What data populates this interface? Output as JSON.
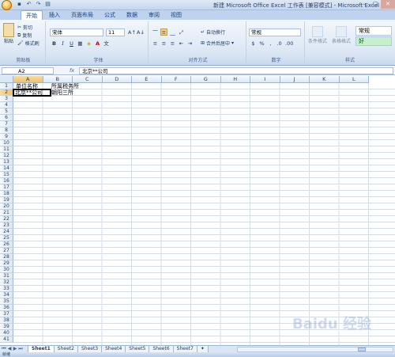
{
  "window": {
    "title": "新建 Microsoft Office Excel 工作表 [兼容模式] - Microsoft Excel",
    "quick_access": [
      "save-icon",
      "undo-icon",
      "redo-icon",
      "print-preview-icon"
    ]
  },
  "ribbon": {
    "tabs": [
      "开始",
      "插入",
      "页面布局",
      "公式",
      "数据",
      "审阅",
      "视图"
    ],
    "active_tab": "开始",
    "clipboard": {
      "paste": "粘贴",
      "cut": "剪切",
      "copy": "复制",
      "format_painter": "格式刷",
      "label": "剪贴板"
    },
    "font": {
      "name": "宋体",
      "size": "11",
      "label": "字体"
    },
    "alignment": {
      "wrap": "自动换行",
      "merge": "合并后居中",
      "label": "对齐方式"
    },
    "number": {
      "format": "常规",
      "percent": "%",
      "comma": ",",
      "label": "数字"
    },
    "styles": {
      "conditional": "条件格式",
      "table": "套用表格格式",
      "table_short": "表格格式",
      "normal": "常规",
      "good": "好",
      "label": "样式"
    }
  },
  "formula_bar": {
    "name_box": "A2",
    "fx": "fx",
    "value": "北京**公司"
  },
  "grid": {
    "columns": [
      "A",
      "B",
      "C",
      "D",
      "E",
      "F",
      "G",
      "H",
      "I",
      "J",
      "K",
      "L"
    ],
    "rows": [
      "1",
      "2",
      "3",
      "4",
      "5",
      "6",
      "7",
      "8",
      "9",
      "10",
      "11",
      "12",
      "13",
      "14",
      "15",
      "16",
      "17",
      "18",
      "19",
      "20",
      "21",
      "22",
      "23",
      "24",
      "25",
      "26",
      "27",
      "28",
      "29",
      "30",
      "31",
      "32",
      "33",
      "34",
      "35",
      "36",
      "37",
      "38",
      "39",
      "40",
      "41"
    ],
    "cells": {
      "A1": "单位名称",
      "B1": "所属税务所",
      "A2": "北京**公司",
      "B2": "朝阳三所"
    }
  },
  "sheets": {
    "tabs": [
      "Sheet1",
      "Sheet2",
      "Sheet3",
      "Sheet4",
      "Sheet5",
      "Sheet6",
      "Sheet7"
    ],
    "active": "Sheet1"
  },
  "status": {
    "text": "就绪"
  },
  "watermark": "Baidu 经验"
}
